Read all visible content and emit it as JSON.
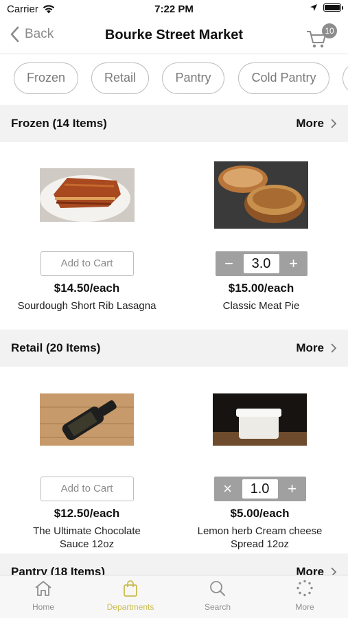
{
  "status": {
    "carrier": "Carrier",
    "time": "7:22 PM"
  },
  "nav": {
    "back_label": "Back",
    "title": "Bourke Street Market",
    "cart_count": "10"
  },
  "chips": [
    "Frozen",
    "Retail",
    "Pantry",
    "Cold Pantry"
  ],
  "sections": [
    {
      "label": "Frozen (14 Items)",
      "more": "More",
      "products": [
        {
          "action": "add",
          "add_label": "Add to Cart",
          "price": "$14.50/each",
          "name": "Sourdough Short Rib Lasagna"
        },
        {
          "action": "stepper",
          "qty": "3.0",
          "minus": "−",
          "plus": "+",
          "price": "$15.00/each",
          "name": "Classic Meat Pie"
        }
      ]
    },
    {
      "label": "Retail (20 Items)",
      "more": "More",
      "products": [
        {
          "action": "add",
          "add_label": "Add to Cart",
          "price": "$12.50/each",
          "name_line1": "The Ultimate Chocolate",
          "name_line2": "Sauce 12oz"
        },
        {
          "action": "stepper",
          "qty": "1.0",
          "minus": "×",
          "plus": "+",
          "price": "$5.00/each",
          "name_line1": "Lemon herb Cream cheese",
          "name_line2": "Spread 12oz"
        }
      ]
    },
    {
      "label": "Pantry (18 Items)",
      "more": "More"
    }
  ],
  "tabs": [
    {
      "label": "Home",
      "icon": "home-icon"
    },
    {
      "label": "Departments",
      "icon": "shopping-bag-icon"
    },
    {
      "label": "Search",
      "icon": "search-icon"
    },
    {
      "label": "More",
      "icon": "more-dots-icon"
    }
  ],
  "colors": {
    "accent": "#c9bc4c",
    "stepper": "#a0a0a0",
    "section_bg": "#f2f2f2"
  }
}
